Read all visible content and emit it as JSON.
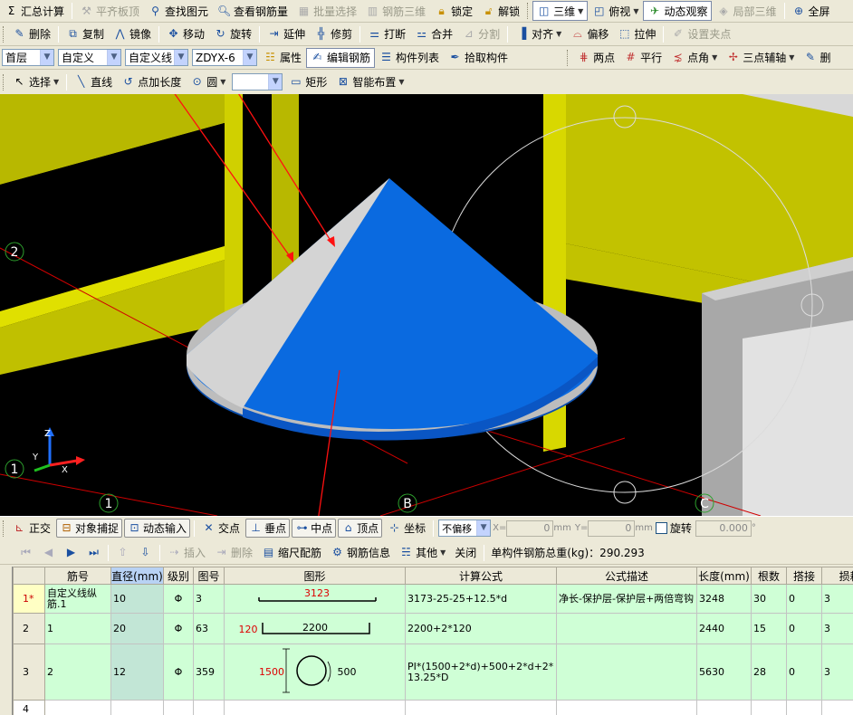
{
  "toolbar1": {
    "sum_calc": "汇总计算",
    "flush_level": "平齐板顶",
    "find_element": "查找图元",
    "view_rebar_qty": "查看钢筋量",
    "batch_select": "批量选择",
    "rebar_3d": "钢筋三维",
    "lock": "锁定",
    "unlock": "解锁",
    "view_3d": "三维",
    "top_view": "俯视",
    "dynamic_observe": "动态观察",
    "local_3d": "局部三维",
    "fullscreen": "全屏"
  },
  "toolbar2": {
    "delete": "删除",
    "copy": "复制",
    "mirror": "镜像",
    "move": "移动",
    "rotate": "旋转",
    "extend": "延伸",
    "trim": "修剪",
    "break": "打断",
    "merge": "合并",
    "split": "分割",
    "align": "对齐",
    "offset": "偏移",
    "stretch": "拉伸",
    "set_grip": "设置夹点"
  },
  "toolbar3": {
    "floor": "首层",
    "category": "自定义",
    "type": "自定义线",
    "name": "ZDYX-6",
    "properties": "属性",
    "edit_rebar": "编辑钢筋",
    "component_list": "构件列表",
    "pick_component": "拾取构件",
    "two_points": "两点",
    "parallel": "平行",
    "point_angle": "点角",
    "three_point_axis": "三点辅轴",
    "delete_short": "删"
  },
  "toolbar4": {
    "select": "选择",
    "line": "直线",
    "point_add_length": "点加长度",
    "circle": "圆",
    "rectangle": "矩形",
    "smart_layout": "智能布置"
  },
  "viewport": {
    "axis_labels": [
      "2",
      "1",
      "1",
      "B",
      "C"
    ]
  },
  "statusbar": {
    "ortho": "正交",
    "object_snap": "对象捕捉",
    "dynamic_input": "动态输入",
    "intersection": "交点",
    "perpendicular": "垂点",
    "midpoint": "中点",
    "vertex": "顶点",
    "coordinate": "坐标",
    "offset_mode": "不偏移",
    "x_label": "X=",
    "x_value": "0",
    "y_label": "Y=",
    "y_value": "0",
    "unit": "mm",
    "rotate": "旋转",
    "rotate_value": "0.000",
    "degree": "°"
  },
  "grid_toolbar": {
    "insert": "插入",
    "delete": "删除",
    "scale_rebar": "缩尺配筋",
    "rebar_info": "钢筋信息",
    "other": "其他",
    "close": "关闭",
    "total_weight": "单构件钢筋总重(kg)：290.293"
  },
  "table": {
    "headers": [
      "",
      "筋号",
      "直径(mm)",
      "级别",
      "图号",
      "图形",
      "计算公式",
      "公式描述",
      "长度(mm)",
      "根数",
      "搭接",
      "损耗("
    ],
    "rows": [
      {
        "idx": "1*",
        "name": "自定义线纵筋.1",
        "dia": "10",
        "grade": "Φ",
        "fig": "3",
        "shape_label": "3123",
        "formula": "3173-25-25+12.5*d",
        "desc": "净长-保护层-保护层+两倍弯钩",
        "length": "3248",
        "count": "30",
        "lap": "0",
        "loss": "3"
      },
      {
        "idx": "2",
        "name": "1",
        "dia": "20",
        "grade": "Φ",
        "fig": "63",
        "shape_side": "120",
        "shape_label": "2200",
        "formula": "2200+2*120",
        "desc": "",
        "length": "2440",
        "count": "15",
        "lap": "0",
        "loss": "3"
      },
      {
        "idx": "3",
        "name": "2",
        "dia": "12",
        "grade": "Φ",
        "fig": "359",
        "shape_side": "1500",
        "shape_label": "500",
        "formula": "PI*(1500+2*d)+500+2*d+2*13.25*D",
        "desc": "",
        "length": "5630",
        "count": "28",
        "lap": "0",
        "loss": "3"
      },
      {
        "idx": "4",
        "name": "",
        "dia": "",
        "grade": "",
        "fig": "",
        "formula": "",
        "desc": "",
        "length": "",
        "count": "",
        "lap": "",
        "loss": ""
      }
    ]
  },
  "colors": {
    "cone_blue": "#0a6ae0",
    "cone_gray": "#d4d4d4",
    "wall_yellow": "#bcbc00",
    "table_row": "#cfffd6",
    "annotation_red": "#ff1010"
  }
}
